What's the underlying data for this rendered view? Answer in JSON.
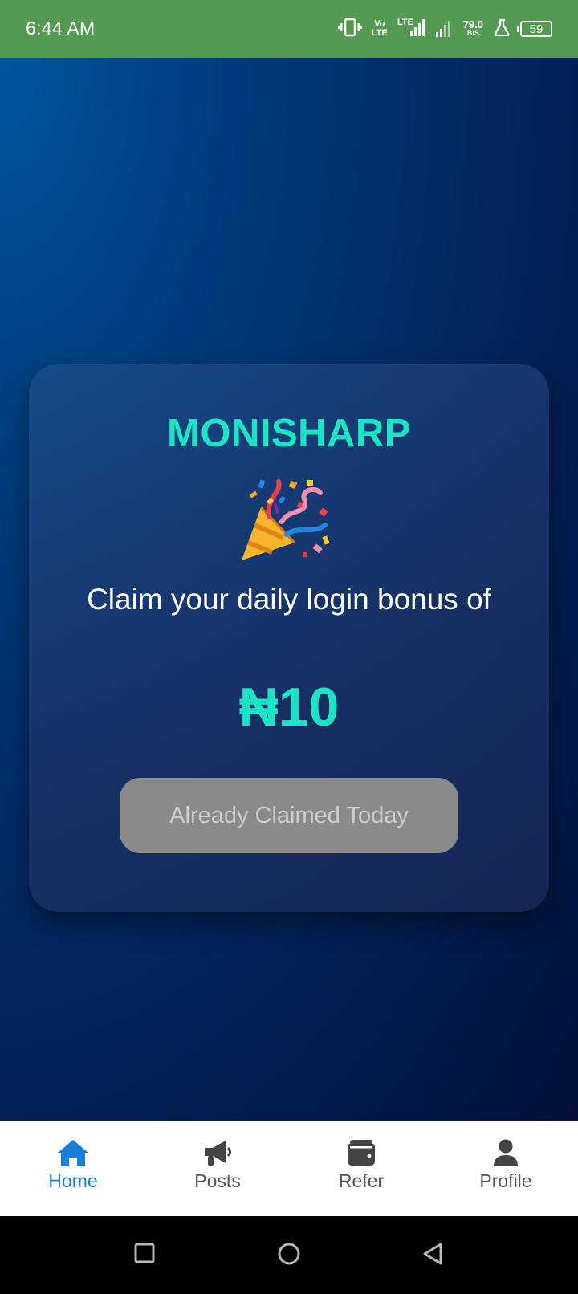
{
  "status_bar": {
    "time": "6:44 AM",
    "network_speed_value": "79.0",
    "network_speed_unit": "B/S",
    "volte_top": "Vo",
    "volte_bottom": "LTE",
    "lte_label": "LTE",
    "battery_level": "59",
    "background_color": "#559a53",
    "icons": [
      "vibrate-icon",
      "volte-icon",
      "lte-signal-icon",
      "signal-icon",
      "network-speed",
      "lab-flask-icon",
      "battery-icon"
    ]
  },
  "card": {
    "brand": "MONISHARP",
    "emoji": "🎉",
    "emoji_name": "party-popper-icon",
    "message": "Claim your daily login bonus of",
    "amount": "₦10",
    "button_label": "Already Claimed Today",
    "accent_color": "#19e6c7"
  },
  "bottom_nav": {
    "items": [
      {
        "label": "Home",
        "icon": "home-icon",
        "active": true
      },
      {
        "label": "Posts",
        "icon": "megaphone-icon",
        "active": false
      },
      {
        "label": "Refer",
        "icon": "wallet-icon",
        "active": false
      },
      {
        "label": "Profile",
        "icon": "user-icon",
        "active": false
      }
    ],
    "active_color": "#1a7fd8"
  },
  "system_nav": {
    "icons": [
      "recent-apps-icon",
      "home-circle-icon",
      "back-icon"
    ]
  }
}
